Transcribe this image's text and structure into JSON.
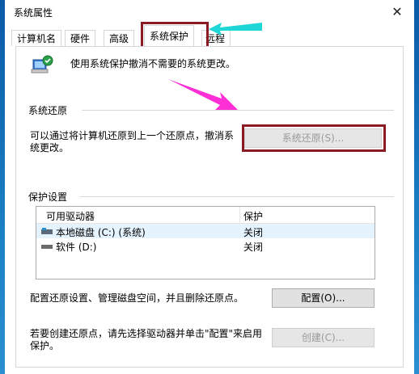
{
  "window": {
    "title": "系统属性"
  },
  "tabs": [
    {
      "label": "计算机名"
    },
    {
      "label": "硬件"
    },
    {
      "label": "高级"
    },
    {
      "label": "系统保护",
      "active": true
    },
    {
      "label": "远程"
    }
  ],
  "intro": {
    "text": "使用系统保护撤消不需要的系统更改。"
  },
  "restore": {
    "group_label": "系统还原",
    "description": "可以通过将计算机还原到上一个还原点，撤消系统更改。",
    "button": "系统还原(S)..."
  },
  "protection": {
    "group_label": "保护设置",
    "columns": [
      "可用驱动器",
      "保护"
    ],
    "rows": [
      {
        "drive": "本地磁盘 (C:) (系统)",
        "status": "关闭",
        "icon": "system-drive-icon"
      },
      {
        "drive": "软件 (D:)",
        "status": "关闭",
        "icon": "drive-icon"
      }
    ],
    "configure_text": "配置还原设置、管理磁盘空间，并且删除还原点。",
    "configure_button": "配置(O)...",
    "create_text": "若要创建还原点，请先选择驱动器并单击\"配置\"来启用保护。",
    "create_button": "创建(C)..."
  },
  "colors": {
    "highlight_box": "#8b1a22",
    "annotation_cyan": "#1fd6d6",
    "annotation_magenta": "#ff2fd6"
  }
}
